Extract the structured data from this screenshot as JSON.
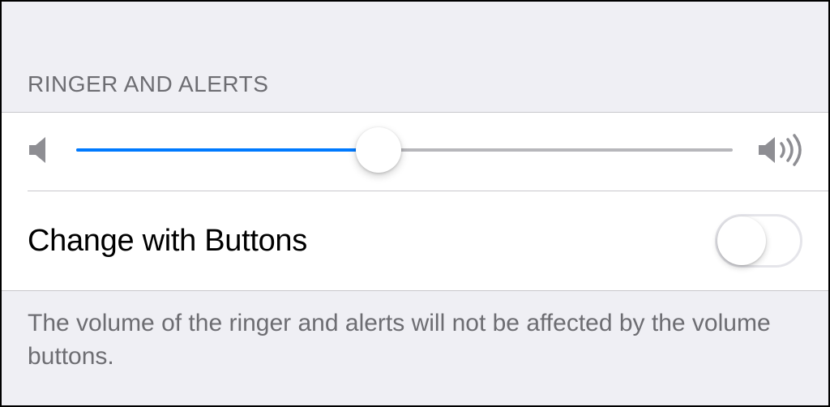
{
  "section": {
    "header": "RINGER AND ALERTS",
    "slider": {
      "value_percent": 46
    },
    "toggle": {
      "label": "Change with Buttons",
      "on": false
    },
    "footer": "The volume of the ringer and alerts will not be affected by the volume buttons."
  }
}
